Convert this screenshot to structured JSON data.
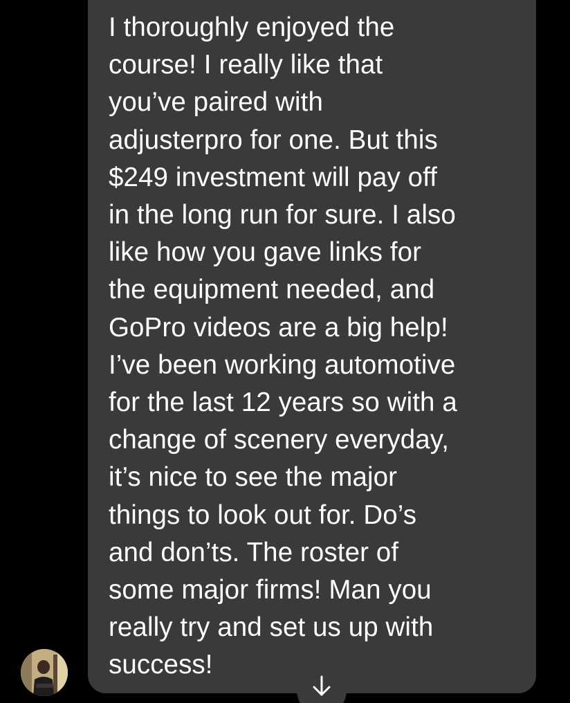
{
  "colors": {
    "background": "#000000",
    "bubble": "#3a3a3c",
    "text": "#ffffff"
  },
  "message": {
    "text": "I thoroughly enjoyed the\ncourse! I really like that\nyou’ve paired with\nadjusterpro for one. But this\n$249  investment will pay off\nin the long run for sure. I also\nlike how you gave links for\nthe equipment needed, and\nGoPro videos are a big help!\nI’ve been working automotive\nfor the last 12 years so with a\nchange of scenery everyday,\nit’s nice to see the major\nthings to look out for. Do’s\nand don’ts. The roster of\nsome major firms! Man you\nreally try and set us up with\nsuccess!"
  },
  "icons": {
    "avatar": "sender-avatar-photo",
    "scroll": "arrow-down-icon"
  }
}
